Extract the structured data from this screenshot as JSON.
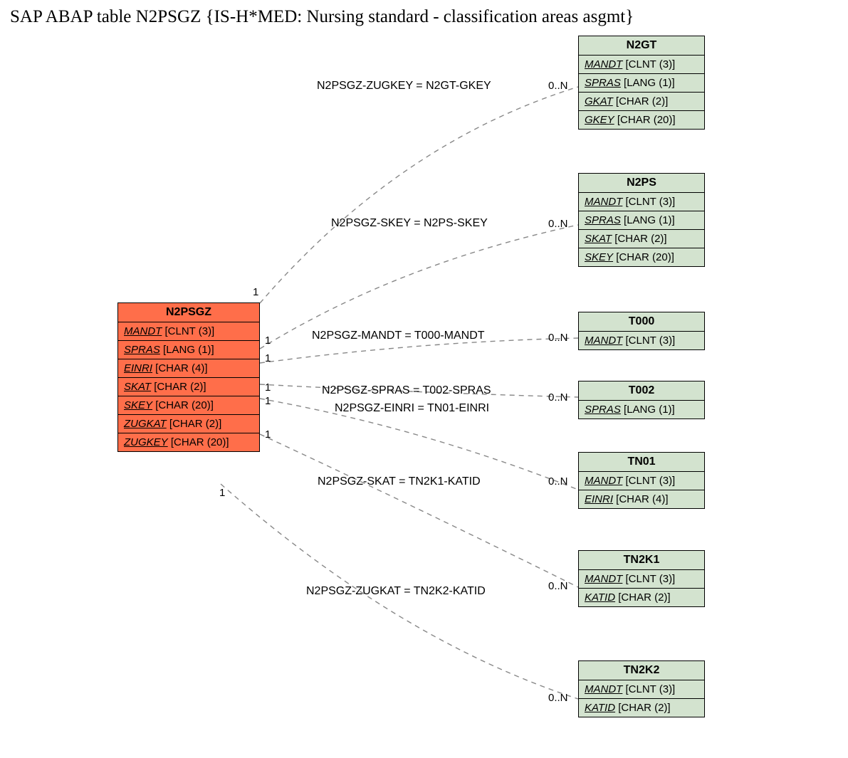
{
  "title": "SAP ABAP table N2PSGZ {IS-H*MED: Nursing standard - classification areas asgmt}",
  "main": {
    "name": "N2PSGZ",
    "fields": [
      {
        "n": "MANDT",
        "t": "[CLNT (3)]"
      },
      {
        "n": "SPRAS",
        "t": "[LANG (1)]"
      },
      {
        "n": "EINRI",
        "t": "[CHAR (4)]"
      },
      {
        "n": "SKAT",
        "t": "[CHAR (2)]"
      },
      {
        "n": "SKEY",
        "t": "[CHAR (20)]"
      },
      {
        "n": "ZUGKAT",
        "t": "[CHAR (2)]"
      },
      {
        "n": "ZUGKEY",
        "t": "[CHAR (20)]"
      }
    ]
  },
  "targets": [
    {
      "name": "N2GT",
      "fields": [
        {
          "n": "MANDT",
          "t": "[CLNT (3)]"
        },
        {
          "n": "SPRAS",
          "t": "[LANG (1)]"
        },
        {
          "n": "GKAT",
          "t": "[CHAR (2)]"
        },
        {
          "n": "GKEY",
          "t": "[CHAR (20)]"
        }
      ]
    },
    {
      "name": "N2PS",
      "fields": [
        {
          "n": "MANDT",
          "t": "[CLNT (3)]"
        },
        {
          "n": "SPRAS",
          "t": "[LANG (1)]"
        },
        {
          "n": "SKAT",
          "t": "[CHAR (2)]"
        },
        {
          "n": "SKEY",
          "t": "[CHAR (20)]"
        }
      ]
    },
    {
      "name": "T000",
      "fields": [
        {
          "n": "MANDT",
          "t": "[CLNT (3)]"
        }
      ]
    },
    {
      "name": "T002",
      "fields": [
        {
          "n": "SPRAS",
          "t": "[LANG (1)]"
        }
      ]
    },
    {
      "name": "TN01",
      "fields": [
        {
          "n": "MANDT",
          "t": "[CLNT (3)]"
        },
        {
          "n": "EINRI",
          "t": "[CHAR (4)]"
        }
      ]
    },
    {
      "name": "TN2K1",
      "fields": [
        {
          "n": "MANDT",
          "t": "[CLNT (3)]"
        },
        {
          "n": "KATID",
          "t": "[CHAR (2)]"
        }
      ]
    },
    {
      "name": "TN2K2",
      "fields": [
        {
          "n": "MANDT",
          "t": "[CLNT (3)]"
        },
        {
          "n": "KATID",
          "t": "[CHAR (2)]"
        }
      ]
    }
  ],
  "rels": [
    {
      "label": "N2PSGZ-ZUGKEY = N2GT-GKEY",
      "lc": "1",
      "rc": "0..N"
    },
    {
      "label": "N2PSGZ-SKEY = N2PS-SKEY",
      "lc": "1",
      "rc": "0..N"
    },
    {
      "label": "N2PSGZ-MANDT = T000-MANDT",
      "lc": "1",
      "rc": "0..N"
    },
    {
      "label": "N2PSGZ-SPRAS = T002-SPRAS",
      "lc": "1",
      "rc": "0..N"
    },
    {
      "label": "N2PSGZ-EINRI = TN01-EINRI",
      "lc": "1",
      "rc": ""
    },
    {
      "label": "N2PSGZ-SKAT = TN2K1-KATID",
      "lc": "1",
      "rc": "0..N"
    },
    {
      "label": "N2PSGZ-ZUGKAT = TN2K2-KATID",
      "lc": "1",
      "rc": "0..N"
    }
  ]
}
